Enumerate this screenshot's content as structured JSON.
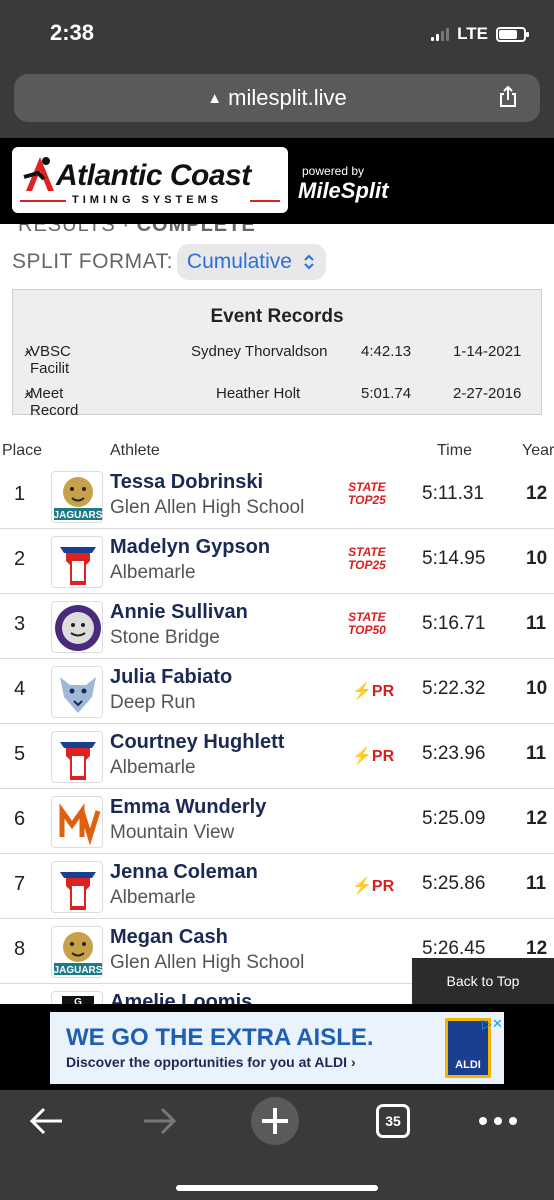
{
  "status_bar": {
    "time": "2:38",
    "network": "LTE",
    "signal_bars": 2,
    "battery_level": 0.75
  },
  "browser": {
    "url": "milesplit.live",
    "tab_count": "35"
  },
  "header": {
    "logo_text": "Atlantic Coast",
    "logo_subtext": "TIMING SYSTEMS",
    "powered_by": "powered by",
    "milesplit": "MileSplit"
  },
  "results_status": {
    "label": "RESULTS",
    "separator": "·",
    "value": "COMPLETE"
  },
  "split_format": {
    "label": "SPLIT FORMAT:",
    "value": "Cumulative"
  },
  "event_records": {
    "title": "Event Records",
    "rows": [
      {
        "mark": "x",
        "name": "VBSC Facilit",
        "holder": "Sydney Thorvaldson",
        "time": "4:42.13",
        "date": "1-14-2021"
      },
      {
        "mark": "x",
        "name": "Meet Record",
        "holder": "Heather Holt",
        "time": "5:01.74",
        "date": "2-27-2016"
      }
    ]
  },
  "table": {
    "headers": {
      "place": "Place",
      "athlete": "Athlete",
      "time": "Time",
      "year": "Year"
    },
    "rows": [
      {
        "place": "1",
        "name": "Tessa Dobrinski",
        "school": "Glen Allen High School",
        "badge_type": "state",
        "badge_line1": "STATE",
        "badge_line2": "TOP25",
        "time": "5:11.31",
        "year": "12",
        "logo": "jaguar-logo"
      },
      {
        "place": "2",
        "name": "Madelyn Gypson",
        "school": "Albemarle",
        "badge_type": "state",
        "badge_line1": "STATE",
        "badge_line2": "TOP25",
        "time": "5:14.95",
        "year": "10",
        "logo": "patriot-logo"
      },
      {
        "place": "3",
        "name": "Annie Sullivan",
        "school": "Stone Bridge",
        "badge_type": "state",
        "badge_line1": "STATE",
        "badge_line2": "TOP50",
        "time": "5:16.71",
        "year": "11",
        "logo": "bulldog-logo"
      },
      {
        "place": "4",
        "name": "Julia Fabiato",
        "school": "Deep Run",
        "badge_type": "pr",
        "badge_line1": "PR",
        "badge_line2": "",
        "time": "5:22.32",
        "year": "10",
        "logo": "wildcat-logo"
      },
      {
        "place": "5",
        "name": "Courtney Hughlett",
        "school": "Albemarle",
        "badge_type": "pr",
        "badge_line1": "PR",
        "badge_line2": "",
        "time": "5:23.96",
        "year": "11",
        "logo": "patriot-logo"
      },
      {
        "place": "6",
        "name": "Emma Wunderly",
        "school": "Mountain View",
        "badge_type": "none",
        "badge_line1": "",
        "badge_line2": "",
        "time": "5:25.09",
        "year": "12",
        "logo": "mv-logo"
      },
      {
        "place": "7",
        "name": "Jenna Coleman",
        "school": "Albemarle",
        "badge_type": "pr",
        "badge_line1": "PR",
        "badge_line2": "",
        "time": "5:25.86",
        "year": "11",
        "logo": "patriot-logo"
      },
      {
        "place": "8",
        "name": "Megan Cash",
        "school": "Glen Allen High School",
        "badge_type": "none",
        "badge_line1": "",
        "badge_line2": "",
        "time": "5:26.45",
        "year": "12",
        "logo": "jaguar-logo"
      },
      {
        "place": "",
        "name": "Amelie Loomis",
        "school": "",
        "badge_type": "none",
        "badge_line1": "",
        "badge_line2": "",
        "time": "",
        "year": "",
        "logo": "g-logo"
      }
    ]
  },
  "back_to_top": "Back to Top",
  "ad": {
    "headline": "WE GO THE EXTRA AISLE.",
    "subline": "Discover the opportunities for you at ALDI",
    "brand": "ALDI"
  },
  "colors": {
    "accent": "#2a6fdb",
    "badge_red": "#d91e1e",
    "athlete_name": "#1a2a55"
  }
}
